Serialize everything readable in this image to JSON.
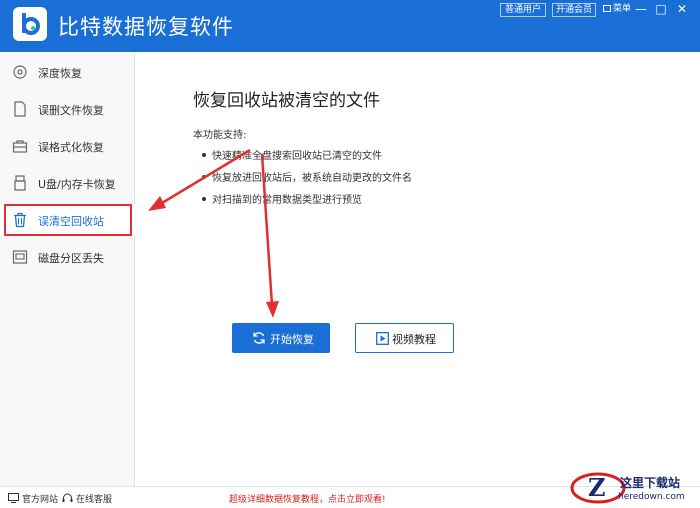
{
  "app": {
    "title": "比特数据恢复软件",
    "brand_color": "#1a6fd6"
  },
  "titlebar": {
    "member_buttons": [
      "普通用户",
      "开通会员"
    ],
    "menu_label": "菜单",
    "window_controls": [
      "minimize-icon",
      "maximize-icon",
      "close-icon"
    ]
  },
  "sidebar": {
    "items": [
      {
        "label": "深度恢复",
        "icon": "deep-scan-icon"
      },
      {
        "label": "误删文件恢复",
        "icon": "file-icon"
      },
      {
        "label": "误格式化恢复",
        "icon": "format-icon"
      },
      {
        "label": "U盘/内存卡恢复",
        "icon": "usb-icon"
      },
      {
        "label": "误清空回收站",
        "icon": "trash-icon",
        "active": true
      },
      {
        "label": "磁盘分区丢失",
        "icon": "disk-icon"
      }
    ],
    "highlight_color": "#e03030"
  },
  "main": {
    "title": "恢复回收站被清空的文件",
    "support_label": "本功能支持:",
    "features": [
      "快速精准全盘搜索回收站已清空的文件",
      "恢复放进回收站后，被系统自动更改的文件名",
      "对扫描到的常用数据类型进行预览"
    ],
    "start_button": "开始恢复",
    "video_button": "视频教程"
  },
  "footer": {
    "website": "官方网站",
    "support": "在线客服",
    "promo": "超级详细数据恢复教程，点击立即观看!"
  },
  "watermark": {
    "text": "这里下载站",
    "sub": "heredown.com"
  }
}
